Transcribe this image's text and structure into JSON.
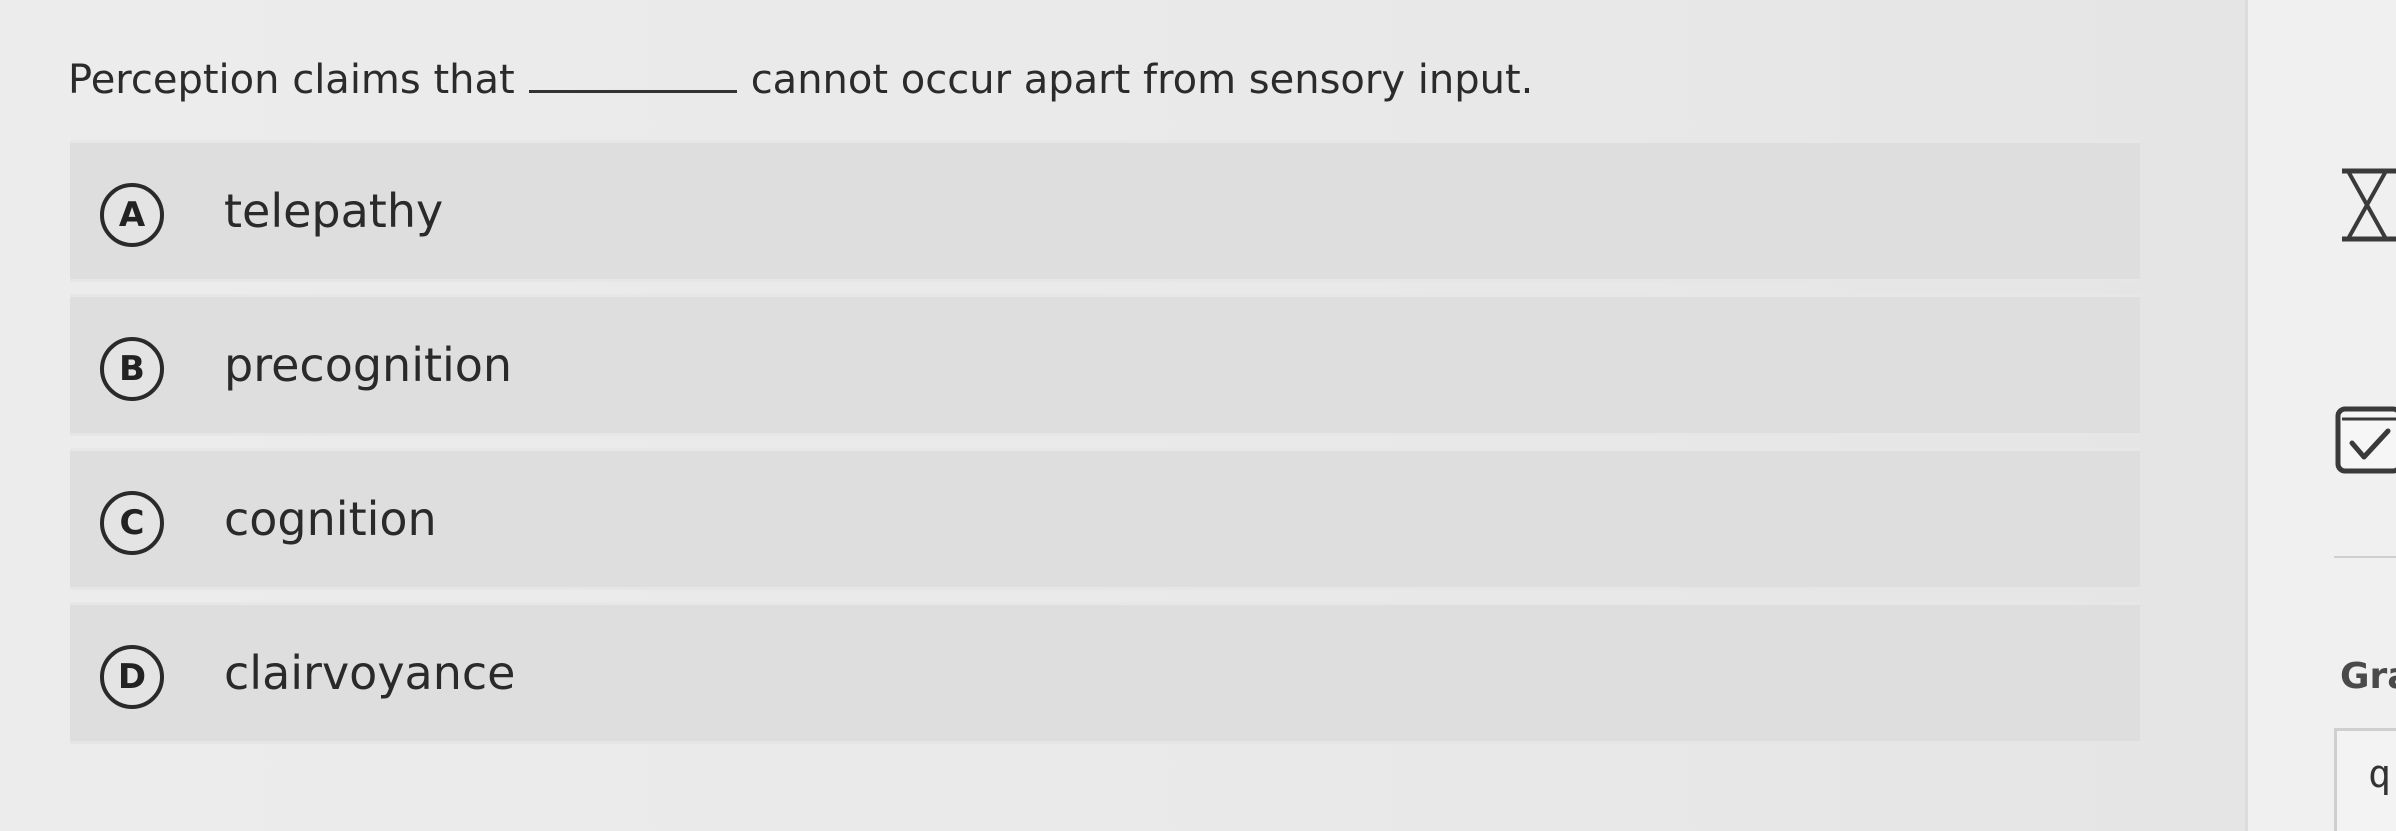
{
  "question": {
    "before_blank": "Perception claims that",
    "after_blank": "cannot occur apart from sensory input."
  },
  "choices": [
    {
      "letter": "A",
      "text": "telepathy"
    },
    {
      "letter": "B",
      "text": "precognition"
    },
    {
      "letter": "C",
      "text": "cognition"
    },
    {
      "letter": "D",
      "text": "clairvoyance"
    }
  ],
  "side_panel": {
    "timer_icon": "hourglass-icon",
    "submit_icon": "checkbox-check-icon",
    "grade_label": "Gra",
    "grade_glyph": "q"
  }
}
